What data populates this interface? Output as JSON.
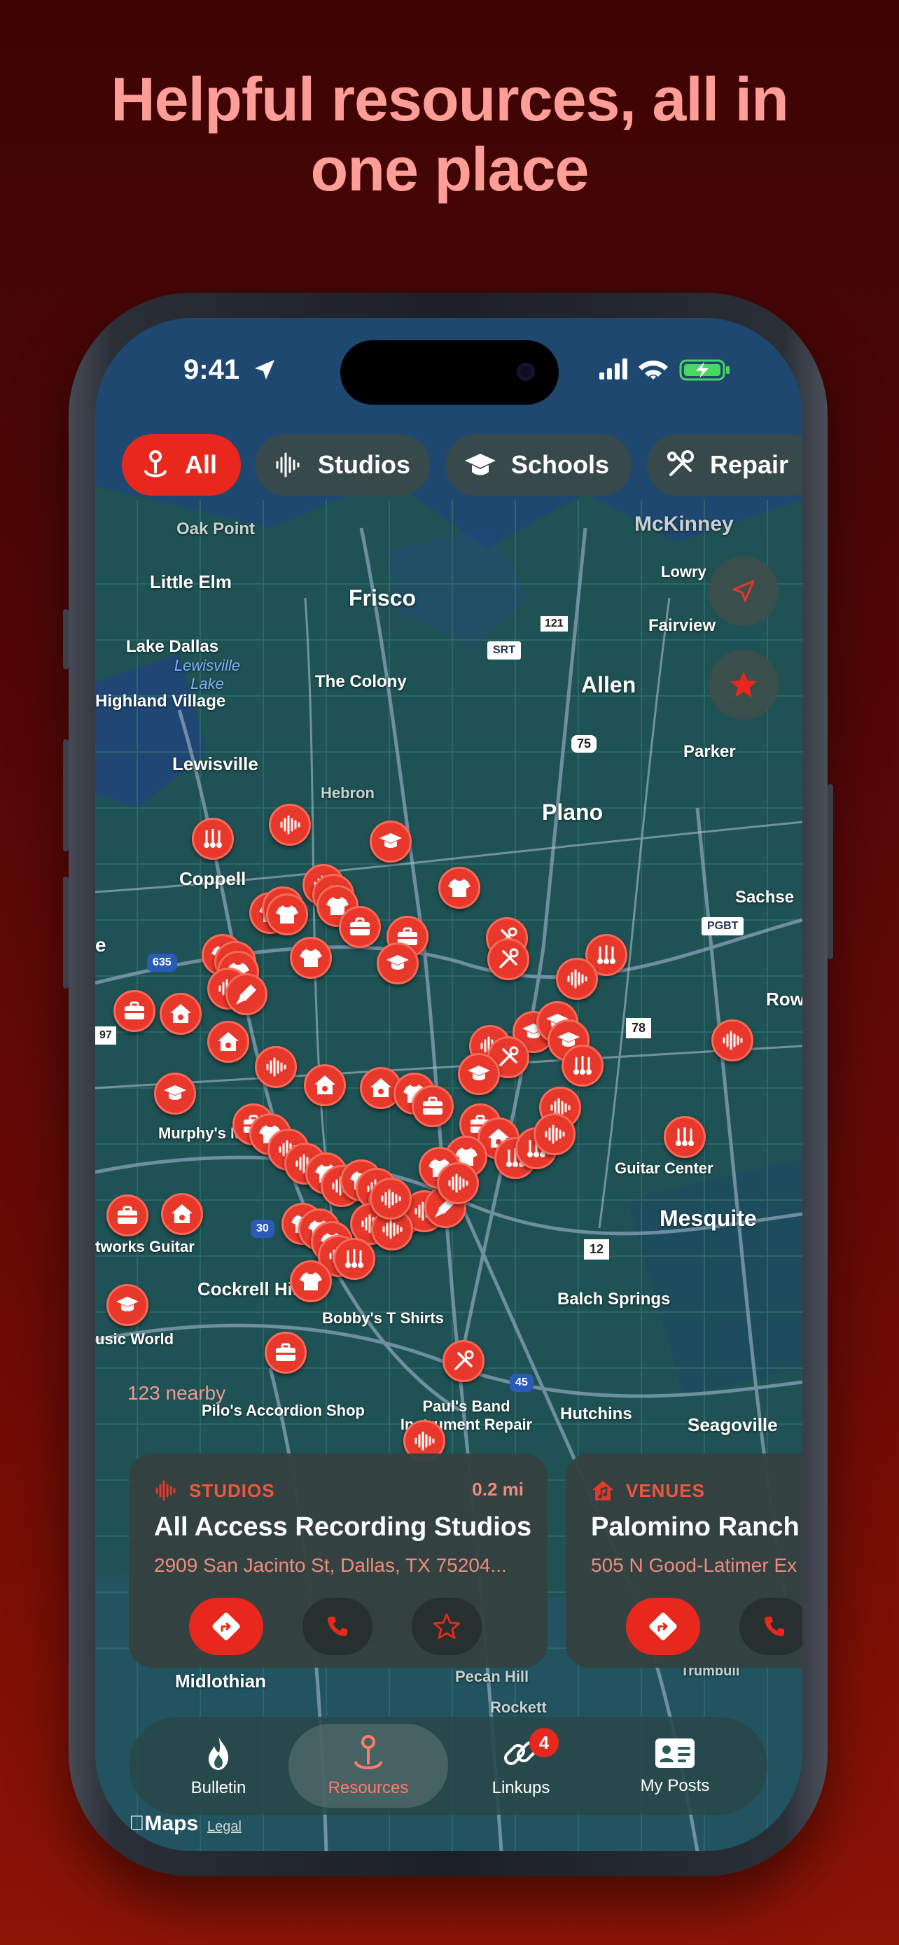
{
  "headline": {
    "line1": "Helpful resources, all in",
    "line2": "one place"
  },
  "status_bar": {
    "time": "9:41"
  },
  "filters": [
    {
      "label": "All",
      "icon": "pin-icon",
      "active": true
    },
    {
      "label": "Studios",
      "icon": "waveform-icon",
      "active": false
    },
    {
      "label": "Schools",
      "icon": "graduation-cap-icon",
      "active": false
    },
    {
      "label": "Repair",
      "icon": "tools-icon",
      "active": false
    }
  ],
  "map_labels": {
    "oak_point": "Oak Point",
    "mckinney": "McKinney",
    "little_elm": "Little Elm",
    "lowry": "Lowry",
    "frisco": "Frisco",
    "fairview": "Fairview",
    "lake_dallas": "Lake Dallas",
    "lewisville_lake": "Lewisville Lake",
    "the_colony": "The Colony",
    "allen": "Allen",
    "highland_village": "Highland Village",
    "parker": "Parker",
    "lewisville": "Lewisville",
    "hebron": "Hebron",
    "plano": "Plano",
    "coppell": "Coppell",
    "sachse": "Sachse",
    "rowlett": "Row",
    "murphys_music": "Murphy's Music",
    "guitar_center": "Guitar Center",
    "mesquite": "Mesquite",
    "networks_guitar": "tworks Guitar",
    "cockrell_hill": "Cockrell Hill",
    "balch_springs": "Balch Springs",
    "bobbys": "Bobby's T Shirts",
    "music_world": "usic World",
    "pilos": "Pilo's Accordion Shop",
    "pauls_band": "Paul's Band Instrument Repair",
    "hutchins": "Hutchins",
    "seagoville": "Seagoville",
    "midlothian": "Midlothian",
    "pecan_hill": "Pecan Hill",
    "rockett": "Rockett",
    "trumbull": "Trumbull",
    "shield_121": "121",
    "shield_srt": "SRT",
    "shield_75": "75",
    "shield_635": "635",
    "shield_pgbt": "PGBT",
    "shield_78": "78",
    "shield_spur97": "97",
    "shield_30": "30",
    "shield_loop12": "12",
    "shield_45": "45",
    "west_edge": "e"
  },
  "nearby_count": "123 nearby",
  "cards": [
    {
      "category": "STUDIOS",
      "distance": "0.2 mi",
      "name": "All Access Recording Studios",
      "address": "2909 San Jacinto St, Dallas, TX  75204..."
    },
    {
      "category": "VENUES",
      "distance": "",
      "name": "Palomino Ranch",
      "address": "505 N Good-Latimer Ex"
    }
  ],
  "tabs": [
    {
      "label": "Bulletin",
      "active": false
    },
    {
      "label": "Resources",
      "active": true
    },
    {
      "label": "Linkups",
      "active": false,
      "badge": "4"
    },
    {
      "label": "My Posts",
      "active": false
    }
  ],
  "attribution": {
    "maps": "Maps",
    "legal": "Legal"
  },
  "colors": {
    "accent": "#e8281c",
    "headline": "#ff9e96",
    "map_base": "#1e4d4f"
  }
}
